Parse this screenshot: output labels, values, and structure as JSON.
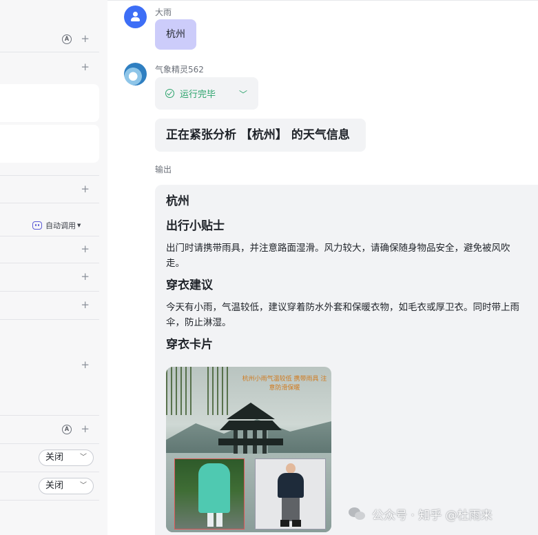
{
  "sidebar": {
    "auto_call_label": "自动调用",
    "selects": [
      {
        "value": "关闭"
      },
      {
        "value": "关闭"
      }
    ]
  },
  "chat": {
    "user": {
      "name": "大雨",
      "message": "杭州"
    },
    "bot": {
      "name": "气象精灵562",
      "status": "运行完毕",
      "analysis": "正在紧张分析 【杭州】 的天气信息",
      "output_label": "输出",
      "output": {
        "city": "杭州",
        "sections": [
          {
            "title": "出行小贴士",
            "text": "出门时请携带雨具，并注意路面湿滑。风力较大，请确保随身物品安全，避免被风吹走。"
          },
          {
            "title": "穿衣建议",
            "text": "今天有小雨，气温较低，建议穿着防水外套和保暖衣物，如毛衣或厚卫衣。同时带上雨伞，防止淋湿。"
          },
          {
            "title": "穿衣卡片",
            "text": ""
          }
        ]
      }
    }
  },
  "image_caption_text": "杭州小雨气温较低 携带雨具 注意防滑保暖",
  "watermark": "公众号 · 知乎 @杜雨来",
  "colors": {
    "accent": "#5b5bd6",
    "user_bubble": "#ccccfa",
    "success": "#2aa36b",
    "user_avatar": "#3d6ef6"
  }
}
